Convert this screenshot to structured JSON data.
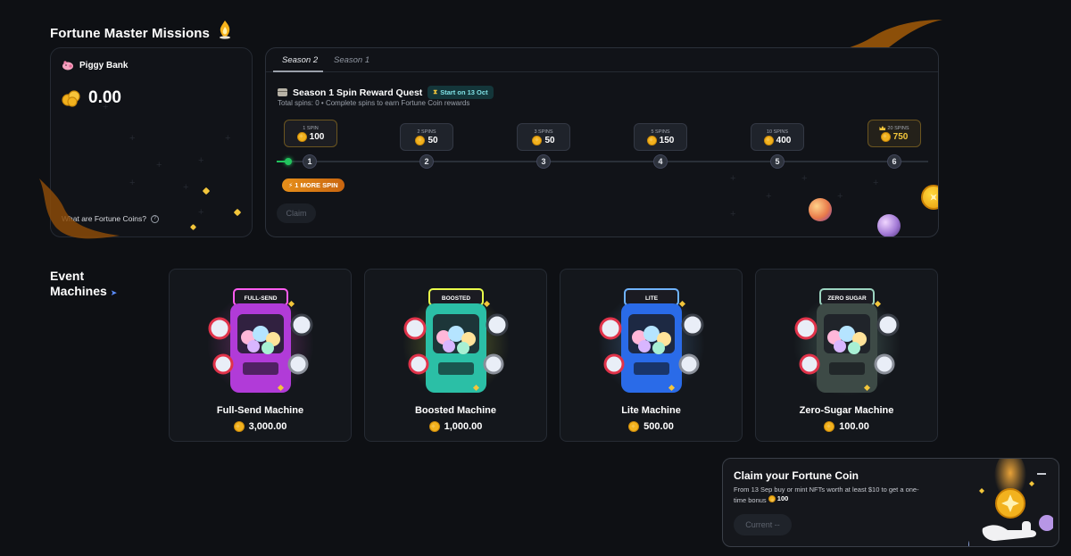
{
  "page": {
    "title": "Fortune Master Missions"
  },
  "piggy_bank": {
    "label": "Piggy Bank",
    "balance": "0.00",
    "link": "What are Fortune Coins?"
  },
  "quest": {
    "tabs": [
      "Season 2",
      "Season 1"
    ],
    "active_tab": "Season 2",
    "title": "Season 1 Spin Reward Quest",
    "badge": "Start on 13 Oct",
    "subtitle": "Total spins: 0  •  Complete spins to earn Fortune Coin rewards",
    "milestones": [
      {
        "label": "1 SPIN",
        "reward": "100",
        "step": "1"
      },
      {
        "label": "2 SPINS",
        "reward": "50",
        "step": "2"
      },
      {
        "label": "3 SPINS",
        "reward": "50",
        "step": "3"
      },
      {
        "label": "5 SPINS",
        "reward": "150",
        "step": "4"
      },
      {
        "label": "10 SPINS",
        "reward": "400",
        "step": "5"
      },
      {
        "label": "20 SPINS",
        "reward": "750",
        "step": "6"
      }
    ],
    "progress_spins": 0,
    "more_spin_label": "1 MORE SPIN",
    "claim_label": "Claim"
  },
  "event_machines": {
    "title_line1": "Event",
    "title_line2": "Machines",
    "items": [
      {
        "name": "Full-Send Machine",
        "price": "3,000.00",
        "sign": "FULL-SEND",
        "color": "#b13bd8",
        "glow": "#ff5cf0"
      },
      {
        "name": "Boosted Machine",
        "price": "1,000.00",
        "sign": "BOOSTED",
        "color": "#2bbfa6",
        "glow": "#e9ff4a"
      },
      {
        "name": "Lite Machine",
        "price": "500.00",
        "sign": "LITE",
        "color": "#2a6be8",
        "glow": "#6fb3ff"
      },
      {
        "name": "Zero-Sugar Machine",
        "price": "100.00",
        "sign": "ZERO SUGAR",
        "color": "#3d4a46",
        "glow": "#9bd4c0"
      }
    ]
  },
  "claim_popup": {
    "title": "Claim your Fortune Coin",
    "text": "From 13 Sep buy or mint NFTs worth at least $10 to get a one-time bonus",
    "bonus": "100",
    "button": "Current --"
  }
}
